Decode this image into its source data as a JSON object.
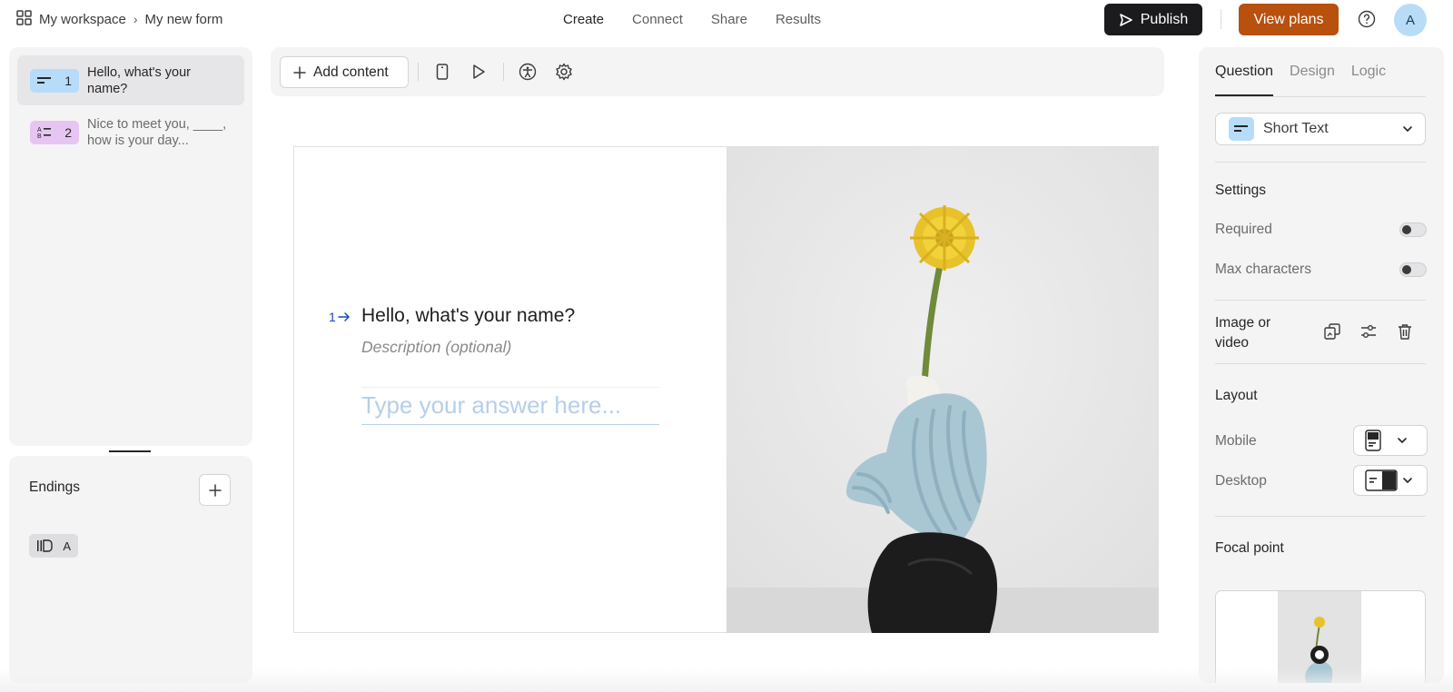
{
  "breadcrumb": {
    "workspace": "My workspace",
    "separator": "›",
    "form": "My new form"
  },
  "nav": {
    "create": "Create",
    "connect": "Connect",
    "share": "Share",
    "results": "Results"
  },
  "actions": {
    "publish": "Publish",
    "view_plans": "View plans",
    "avatar_initial": "A"
  },
  "questions": [
    {
      "number": "1",
      "text": "Hello, what's your name?",
      "type_icon": "short-text-icon",
      "color": "#b6dcfa"
    },
    {
      "number": "2",
      "text": "Nice to meet you, ____, how is your day...",
      "type_icon": "multiple-choice-icon",
      "color": "#e7c5f2"
    }
  ],
  "endings": {
    "title": "Endings",
    "badge_label": "A"
  },
  "toolbar": {
    "add_content": "Add content"
  },
  "canvas": {
    "question_number": "1",
    "question_title": "Hello, what's your name?",
    "description_placeholder": "Description (optional)",
    "answer_placeholder": "Type your answer here..."
  },
  "right_panel": {
    "tabs": {
      "question": "Question",
      "design": "Design",
      "logic": "Logic"
    },
    "question_type": "Short Text",
    "settings_title": "Settings",
    "required_label": "Required",
    "max_chars_label": "Max characters",
    "image_label": "Image or video",
    "layout_title": "Layout",
    "mobile_label": "Mobile",
    "desktop_label": "Desktop",
    "focal_title": "Focal point"
  },
  "colors": {
    "publish_bg": "#1b1b1d",
    "plans_bg": "#b8500e",
    "accent_blue": "#0d4fb4"
  }
}
